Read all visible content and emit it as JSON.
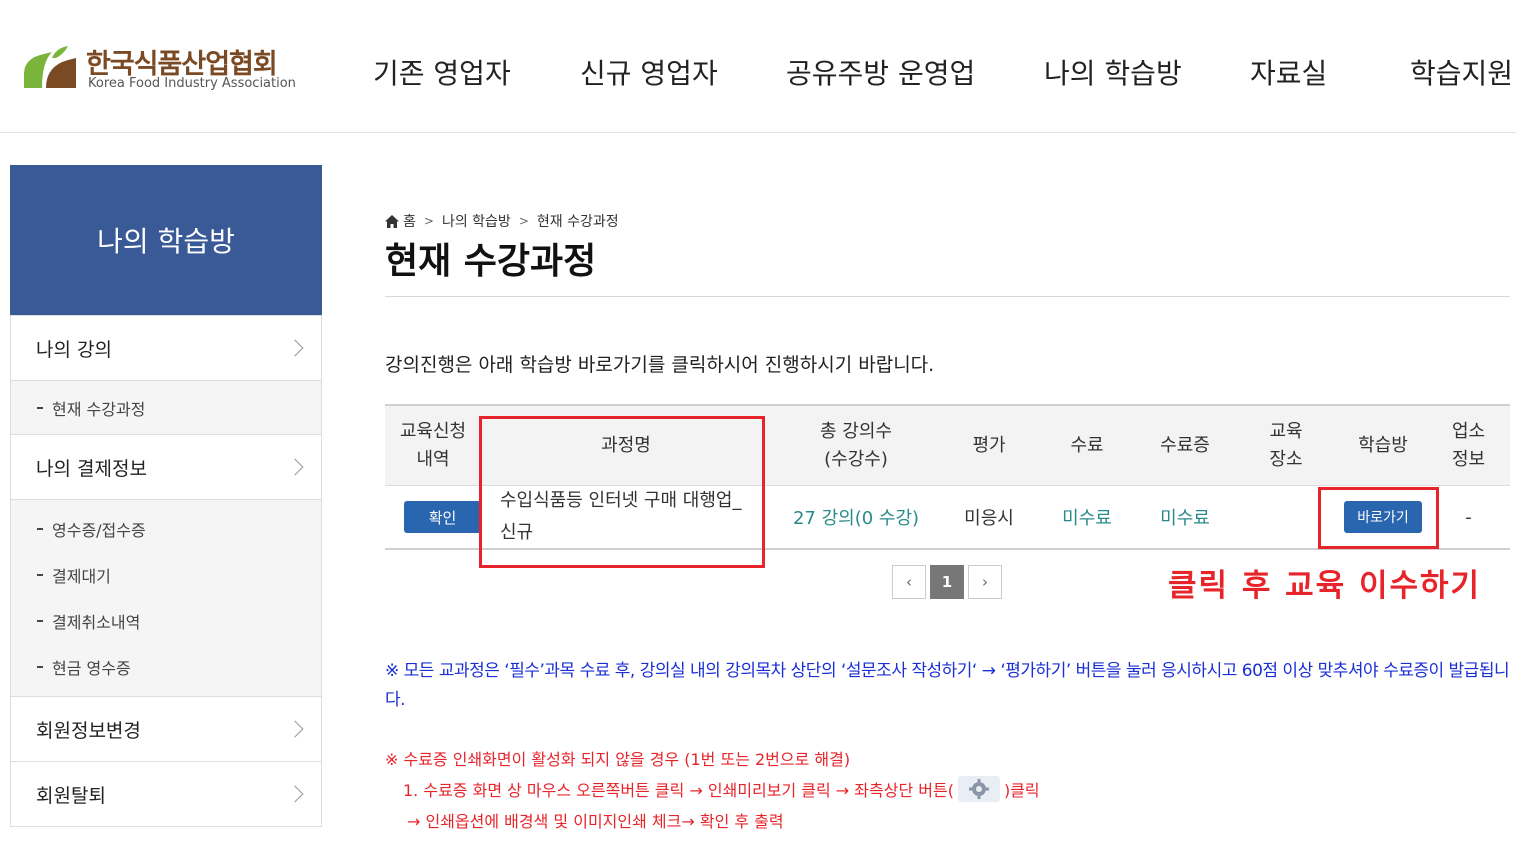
{
  "header": {
    "logo_kr": "한국식품산업협회",
    "logo_en": "Korea Food Industry Association",
    "nav": [
      "기존 영업자",
      "신규 영업자",
      "공유주방 운영업",
      "나의 학습방",
      "자료실",
      "학습지원"
    ]
  },
  "sidebar": {
    "title": "나의 학습방",
    "items": [
      {
        "label": "나의 강의"
      },
      {
        "label": "현재 수강과정"
      },
      {
        "label": "나의 결제정보"
      },
      {
        "label": "영수증/접수증"
      },
      {
        "label": "결제대기"
      },
      {
        "label": "결제취소내역"
      },
      {
        "label": "현금 영수증"
      },
      {
        "label": "회원정보변경"
      },
      {
        "label": "회원탈퇴"
      }
    ]
  },
  "breadcrumb": [
    "홈",
    "나의 학습방",
    "현재 수강과정"
  ],
  "page_title": "현재 수강과정",
  "guide_text": "강의진행은 아래 학습방 바로가기를 클릭하시어 진행하시기 바랍니다.",
  "table": {
    "headers": [
      "교육신청\n내역",
      "과정명",
      "총 강의수\n(수강수)",
      "평가",
      "수료",
      "수료증",
      "교육\n장소",
      "학습방",
      "업소\n정보"
    ],
    "row": {
      "confirm_button": "확인",
      "course_name": "수입식품등 인터넷 구매 대행업_\n신규",
      "lectures": "27 강의(0 수강)",
      "evaluation": "미응시",
      "completion": "미수료",
      "certificate": "미수료",
      "place": "",
      "go_button": "바로가기",
      "business_info": "-"
    }
  },
  "pagination": {
    "prev": "‹",
    "current": "1",
    "next": "›"
  },
  "callout": "클릭 후 교육 이수하기",
  "notes": {
    "blue": "※ 모든 교과정은 ‘필수’과목 수료 후, 강의실 내의 강의목차 상단의 ‘설문조사 작성하기‘ → ‘평가하기’ 버튼을 눌러 응시하시고 60점 이상 맞추셔야 수료증이 발급됩니다.",
    "red_title": "※ 수료증 인쇄화면이 활성화 되지 않을 경우 (1번 또는 2번으로 해결)",
    "red_1a": "1. 수료증 화면 상 마우스 오른쪽버튼 클릭 → 인쇄미리보기 클릭 → 좌측상단 버튼(",
    "red_1b": ")클릭",
    "red_2": "→ 인쇄옵션에 배경색 및 이미지인쇄 체크→ 확인 후 출력"
  },
  "colors": {
    "sidebar_title_bg": "#3a5997",
    "button_blue": "#2a66b0",
    "highlight_red": "#e8242b",
    "teal": "#2a8a8a",
    "note_blue": "#1a2fd6"
  }
}
